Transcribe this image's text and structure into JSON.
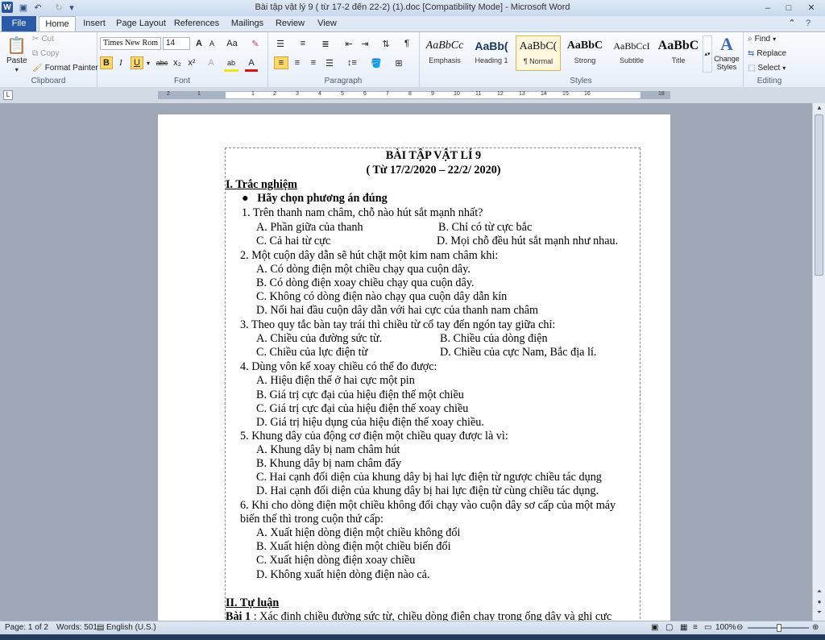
{
  "window": {
    "title": "Bài tập vật lý 9 ( từ 17-2 đến 22-2) (1).doc [Compatibility Mode] - Microsoft Word",
    "logo": "W",
    "controls": {
      "minimize": "–",
      "maximize": "□",
      "close": "✕"
    }
  },
  "ribbon_tabs": [
    "File",
    "Home",
    "Insert",
    "Page Layout",
    "References",
    "Mailings",
    "Review",
    "View"
  ],
  "clipboard": {
    "paste": "Paste",
    "cut": "Cut",
    "copy": "Copy",
    "format_painter": "Format Painter",
    "label": "Clipboard"
  },
  "font": {
    "name": "Times New Rom",
    "size": "14",
    "label": "Font",
    "bold": "B",
    "italic": "I",
    "underline": "U",
    "strike": "abc",
    "subscript": "x₂",
    "superscript": "x²",
    "grow": "A",
    "shrink": "A",
    "case": "Aa",
    "color": "A",
    "highlight": "ab",
    "effects": "A"
  },
  "paragraph": {
    "label": "Paragraph"
  },
  "styles": {
    "label": "Styles",
    "items": [
      {
        "sample": "AaBbCc",
        "name": "Emphasis"
      },
      {
        "sample": "AaBb(",
        "name": "Heading 1"
      },
      {
        "sample": "AaBbC(",
        "name": "¶ Normal"
      },
      {
        "sample": "AaBbC",
        "name": "Strong"
      },
      {
        "sample": "AaBbCcI",
        "name": "Subtitle"
      },
      {
        "sample": "AaBbC",
        "name": "Title"
      }
    ],
    "change_styles": "Change Styles"
  },
  "editing": {
    "find": "Find",
    "replace": "Replace",
    "select": "Select",
    "label": "Editing"
  },
  "ruler": {
    "numbers": [
      "2",
      "1",
      "1",
      "2",
      "3",
      "4",
      "5",
      "6",
      "7",
      "8",
      "9",
      "10",
      "11",
      "12",
      "13",
      "14",
      "15",
      "16",
      "18"
    ]
  },
  "document": {
    "title": "BÀI TẬP VẬT LÍ 9",
    "date": "( Từ 17/2/2020 – 22/2/ 2020)",
    "section1": "I. Trắc nghiệm",
    "bullet": "Hãy chọn phương án đúng",
    "lines": [
      "1.  Trên thanh nam châm, chỗ nào hút sắt mạnh nhất?",
      "A. Phần giữa của thanh",
      "B. Chỉ có từ cực bắc",
      "C. Cả hai từ cực",
      "D. Mọi chỗ đều hút sắt mạnh như nhau.",
      "2. Một cuộn dây dẫn sẽ hút chặt một kim nam châm khi:",
      "A. Có dòng điện một chiều chạy qua cuộn dây.",
      "B. Có dòng điện xoay chiều chạy qua cuộn dây.",
      "C. Không có dòng điện nào chạy qua cuộn dây dẫn kín",
      "D. Nối hai đầu cuộn dây dẫn với hai cực  của thanh nam châm",
      "3. Theo quy tắc bàn tay trái thì chiều từ cổ tay đến ngón tay giữa chỉ:",
      "A. Chiều của đường sức từ.",
      "B. Chiều của dòng điện",
      "C. Chiều của lực điện từ",
      "D. Chiều của cực Nam, Bắc địa lí.",
      "4. Dùng vôn kế xoay chiều có thể đo được:",
      "A. Hiệu điện thế ở hai cực  một pin",
      "B. Giá trị cực đại của hiệu điện thế một chiều",
      "C. Giá trị cực đại của hiệu điện thế xoay chiều",
      "D. Giá trị hiệu dụng của hiệu điện thế xoay chiều.",
      "5. Khung dây của động cơ điện một chiều quay được là vì:",
      "A. Khung dây bị nam châm hút",
      "B. Khung dây bị nam châm đẩy",
      "C. Hai cạnh đối diện của khung dây bị hai lực điện từ ngược chiều tác dụng",
      "D. Hai cạnh đối diện của khung dây bị hai lực điện từ cùng chiều tác dụng.",
      "6. Khi cho dòng điện một chiều không đổi chạy vào cuộn dây sơ cấp của một máy",
      "biến thế thì trong cuộn thứ cấp:",
      "A. Xuất hiện dòng điện một chiều không đổi",
      "B. Xuất hiện dòng điện một chiều biến đổi",
      "C. Xuất hiện dòng điện xoay chiều",
      "D. Không xuất hiện dòng điện nào cả."
    ],
    "section2": "II. Tự luận",
    "bai1_label": "Bài 1",
    "bai1_text": " : Xác định chiều đường sức từ, chiều dòng điện chạy trong ống dây và ghi cực"
  },
  "status": {
    "page": "Page: 1 of 2",
    "words": "Words: 501",
    "language": "English (U.S.)",
    "zoom": "100%"
  }
}
